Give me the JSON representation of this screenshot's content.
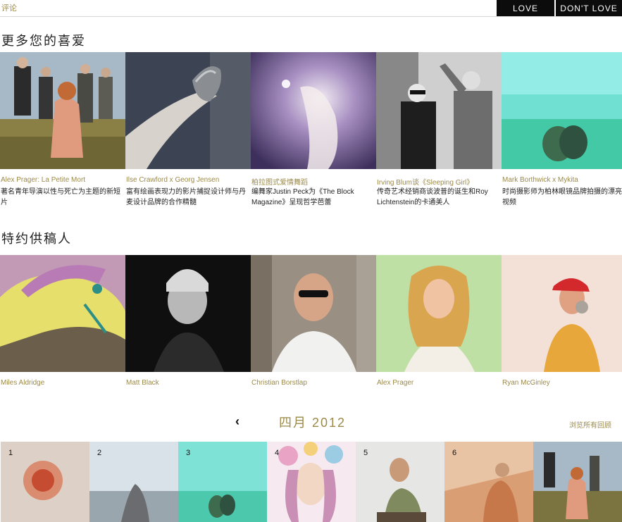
{
  "header": {
    "comment_link": "评论",
    "love": "LOVE",
    "dont_love": "DON'T LOVE"
  },
  "favorites": {
    "title": "更多您的喜爱",
    "items": [
      {
        "title": "Alex Prager: La Petite Mort",
        "desc": "著名青年导演以性与死亡为主题的新短片"
      },
      {
        "title": "Ilse Crawford x Georg Jensen",
        "desc": "富有绘画表现力的影片捕捉设计师与丹麦设计品牌的合作精髓"
      },
      {
        "title": "柏拉图式爱情舞蹈",
        "desc": "编舞家Justin Peck为《The Block Magazine》呈现哲学芭蕾"
      },
      {
        "title": "Irving Blum谈《Sleeping Girl》",
        "desc": "传奇艺术经销商谈波普的诞生和Roy Lichtenstein的卡通美人"
      },
      {
        "title": "Mark Borthwick x Mykita",
        "desc": "时尚摄影师为柏林眼镜品牌拍摄的漂亮视频"
      }
    ]
  },
  "contributors": {
    "title": "特约供稿人",
    "items": [
      {
        "name": "Miles Aldridge"
      },
      {
        "name": "Matt Black"
      },
      {
        "name": "Christian Borstlap"
      },
      {
        "name": "Alex Prager"
      },
      {
        "name": "Ryan McGinley"
      }
    ]
  },
  "calendar": {
    "month": "四月 2012",
    "browse": "浏览所有回顾",
    "days": [
      {
        "num": "1"
      },
      {
        "num": "2"
      },
      {
        "num": "3"
      },
      {
        "num": "4"
      },
      {
        "num": "5"
      },
      {
        "num": "6"
      },
      {
        "num": ""
      }
    ]
  },
  "colors": {
    "accent": "#9b8a4a",
    "button_bg": "#0c0c0c"
  }
}
